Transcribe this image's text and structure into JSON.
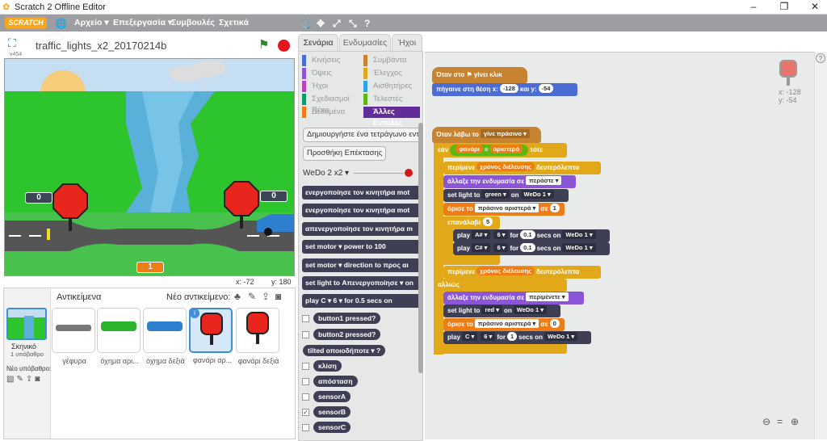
{
  "window": {
    "title": "Scratch 2 Offline Editor",
    "min": "–",
    "max": "❐",
    "close": "✕"
  },
  "menu": {
    "logo": "SCRATCH",
    "file": "Αρχείο ▾",
    "edit": "Επεξεργασία ▾",
    "tips": "Συμβουλές",
    "about": "Σχετικά"
  },
  "stage": {
    "version": "v454",
    "project": "traffic_lights_x2_20170214b",
    "mouse_x": "x: -72",
    "mouse_y": "y: 180",
    "left_counter": "0",
    "right_counter": "0",
    "bottom_counter": "1"
  },
  "sprites": {
    "header": "Αντικείμενα",
    "new_sprite": "Νέο αντικείμενο:",
    "backdrop_label": "Σκηνικό",
    "backdrop_count": "1 υπόβαθρο",
    "new_backdrop": "Νέο υπόβαθρο:",
    "items": [
      {
        "name": "γέφυρα"
      },
      {
        "name": "όχημα αρι..."
      },
      {
        "name": "όχημα δεξιά"
      },
      {
        "name": "φανάρι αρ..."
      },
      {
        "name": "φανάρι δεξιά"
      }
    ]
  },
  "tabs": {
    "scripts": "Σενάρια",
    "costumes": "Ενδυμασίες",
    "sounds": "Ήχοι"
  },
  "categories": [
    {
      "label": "Κινήσεις",
      "color": "#4a6cd4"
    },
    {
      "label": "Συμβάντα",
      "color": "#c88330"
    },
    {
      "label": "Όψεις",
      "color": "#8a55d7"
    },
    {
      "label": "Έλεγχος",
      "color": "#e1a91a"
    },
    {
      "label": "Ήχοι",
      "color": "#bb42c3"
    },
    {
      "label": "Αισθητήρες",
      "color": "#2ca5e2"
    },
    {
      "label": "Σχεδιασμοί Πένα",
      "color": "#0e9a6c"
    },
    {
      "label": "Τελεστές",
      "color": "#5cb712"
    },
    {
      "label": "Δεδομένα",
      "color": "#ee7d16"
    },
    {
      "label": "Άλλες Εντολές",
      "color": "#632d99"
    }
  ],
  "palette": {
    "make_block": "Δημιουργήστε ένα τετράγωνο εντολών",
    "add_extension": "Προσθήκη Επέκτασης",
    "extension_name": "WeDo 2 x2 ▾",
    "blocks": [
      "ενεργοποίησε τον κινητήρα  mot",
      "ενεργοποίησε τον κινητήρα  mot",
      "απενεργοποίησε τον κινητήρα  m",
      "set  motor ▾  power to  100",
      "set  motor ▾  direction to  προς αι",
      "set light to  Απενεργοποίησε ▾  on",
      "play  C ▾  6 ▾  for  0.5  secs on"
    ],
    "reporters": [
      "button1 pressed?",
      "button2 pressed?",
      "tilted  οποιοδήποτε ▾ ?",
      "κλίση",
      "απόσταση",
      "sensorA",
      "sensorB",
      "sensorC"
    ]
  },
  "script": {
    "hat1": "Όταν στο  ⚑  γίνει κλικ",
    "goto": [
      "πήγαινε στη θέση x:",
      "-128",
      "και y:",
      "-54"
    ],
    "hat2": [
      "Όταν λάβω το",
      "γίνε πράσινο ▾"
    ],
    "if": [
      "εάν",
      "φανάρι",
      "=",
      "αριστερό",
      "τότε"
    ],
    "wait": [
      "περίμενε",
      "χρόνος διέλευσης",
      "δευτερόλεπτα"
    ],
    "costume1": [
      "άλλαξε την ενδυμασία σε",
      "περάστε ▾"
    ],
    "light1": [
      "set light to",
      "green ▾",
      "on",
      "WeDo 1 ▾"
    ],
    "set1": [
      "όρισε το",
      "πράσινο αριστερά ▾",
      "σε",
      "1"
    ],
    "repeat": [
      "επανάλαβε",
      "5"
    ],
    "play1": [
      "play",
      "A# ▾",
      "6 ▾",
      "for",
      "0.1",
      "secs on",
      "WeDo 1 ▾"
    ],
    "play2": [
      "play",
      "C# ▾",
      "6 ▾",
      "for",
      "0.1",
      "secs on",
      "WeDo 1 ▾"
    ],
    "else": "αλλιώς",
    "costume2": [
      "άλλαξε την ενδυμασία σε",
      "περιμένετε ▾"
    ],
    "light2": [
      "set light to",
      "red ▾",
      "on",
      "WeDo 1 ▾"
    ],
    "set2": [
      "όρισε το",
      "πράσινο αριστερά ▾",
      "σε",
      "0"
    ],
    "play3": [
      "play",
      "C ▾",
      "6 ▾",
      "for",
      "1",
      "secs on",
      "WeDo 1 ▾"
    ],
    "sprite_x": "x: -128",
    "sprite_y": "y: -54"
  }
}
